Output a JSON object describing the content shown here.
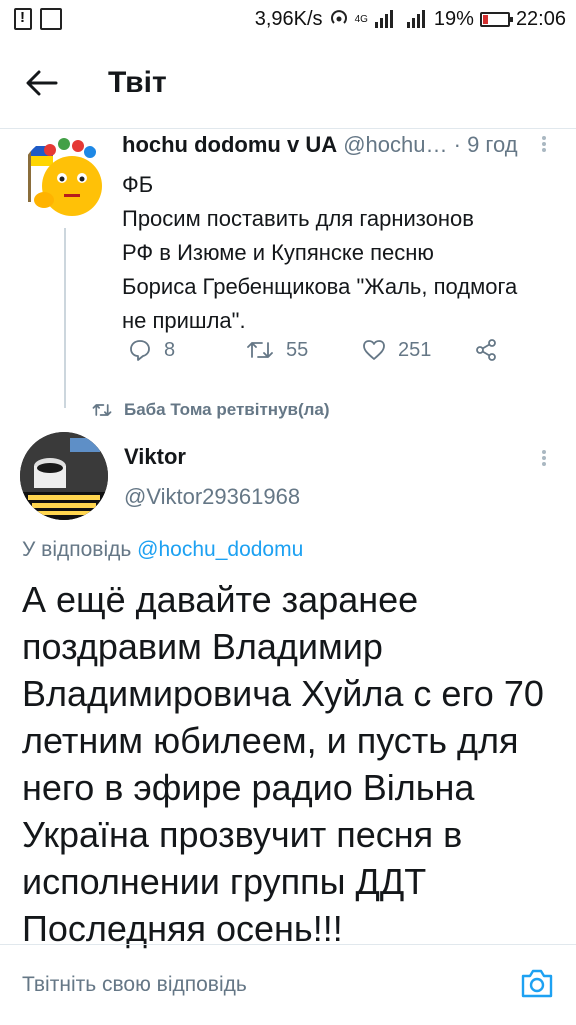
{
  "status_bar": {
    "speed": "3,96K/s",
    "network": "4G",
    "battery_pct": "19%",
    "battery_level": 0.19,
    "time": "22:06"
  },
  "header": {
    "title": "Твіт",
    "back_icon": "arrow-left-icon"
  },
  "tweet1": {
    "name": "hochu dodomu v UA",
    "handle": "@hochu…",
    "time": "· 9 год",
    "body": [
      "ФБ",
      "Просим поставить для гарнизонов",
      "РФ в Изюме и Купянске песню",
      "Бориса Гребенщикова \"Жаль, подмога",
      "не пришла\"."
    ],
    "replies": "8",
    "retweets": "55",
    "likes": "251"
  },
  "retweet_label": "Баба Тома ретвітнув(ла)",
  "tweet2": {
    "name": "Viktor",
    "handle": "@Viktor29361968",
    "replying_prefix": "У відповідь",
    "replying_to": "@hochu_dodomu",
    "body": [
      "А ещё давайте заранее",
      "поздравим Владимир",
      "Владимировича Хуйла с его 70",
      "летним юбилеем, и пусть для",
      "него в эфире радио Вільна",
      "Україна прозвучит песня в",
      "исполнении группы ДДТ",
      "Последняя осень!!!"
    ]
  },
  "reply_bar": {
    "placeholder": "Твітніть свою відповідь"
  },
  "colors": {
    "accent": "#1da1f2",
    "secondary_text": "#657786",
    "divider": "#e1e8ed"
  }
}
